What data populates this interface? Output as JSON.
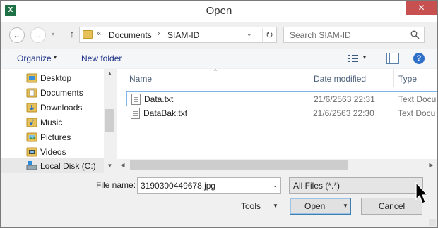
{
  "window": {
    "title": "Open",
    "app_icon": "X",
    "close_glyph": "✕"
  },
  "nav": {
    "back_glyph": "←",
    "forward_glyph": "→",
    "up_glyph": "↑",
    "dropdown_glyph": "▾"
  },
  "address": {
    "overflow": "«",
    "crumbs": [
      "Documents",
      "SIAM-ID"
    ],
    "separator": "›",
    "dropdown_glyph": "⌄",
    "refresh_glyph": "↻"
  },
  "search": {
    "placeholder": "Search SIAM-ID"
  },
  "toolbar": {
    "organize": "Organize",
    "new_folder": "New folder",
    "caret": "▾",
    "help": "?"
  },
  "navpane": {
    "items": [
      {
        "label": "Desktop",
        "icon": "desktop-folder-icon"
      },
      {
        "label": "Documents",
        "icon": "documents-folder-icon"
      },
      {
        "label": "Downloads",
        "icon": "downloads-folder-icon"
      },
      {
        "label": "Music",
        "icon": "music-folder-icon"
      },
      {
        "label": "Pictures",
        "icon": "pictures-folder-icon"
      },
      {
        "label": "Videos",
        "icon": "videos-folder-icon"
      },
      {
        "label": "Local Disk (C:)",
        "icon": "local-disk-icon"
      }
    ],
    "scroll_up": "▲",
    "scroll_down": "▼"
  },
  "filelist": {
    "columns": {
      "name": "Name",
      "date": "Date modified",
      "type": "Type"
    },
    "sort_glyph": "^",
    "rows": [
      {
        "name": "Data.txt",
        "date": "21/6/2563 22:31",
        "type": "Text Docu"
      },
      {
        "name": "DataBak.txt",
        "date": "21/6/2563 22:30",
        "type": "Text Docu"
      }
    ],
    "scroll_left": "◀",
    "scroll_right": "▶"
  },
  "footer": {
    "file_name_label": "File name:",
    "file_name_value": "3190300449678.jpg",
    "filter_value": "All Files (*.*)",
    "dd_glyph": "⌄",
    "tools": "Tools",
    "tools_caret": "▼",
    "open": "Open",
    "open_caret": "▼",
    "cancel": "Cancel"
  },
  "colors": {
    "accent": "#1e3287",
    "folder": "#e6c15a",
    "close": "#c75050",
    "selection": "#7eb4ea"
  }
}
